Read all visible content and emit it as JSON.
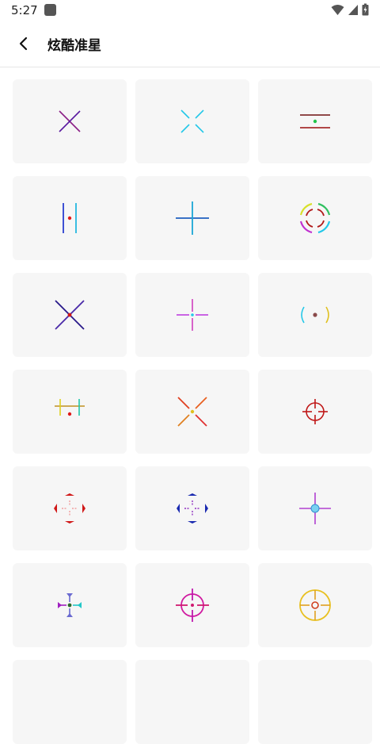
{
  "status_bar": {
    "time": "5:27"
  },
  "header": {
    "title": "炫酷准星"
  },
  "crosshairs": [
    {
      "icon": "crosshair-x-purple-icon"
    },
    {
      "icon": "crosshair-x-cyan-gap-icon"
    },
    {
      "icon": "crosshair-double-line-icon"
    },
    {
      "icon": "crosshair-vertical-bars-icon"
    },
    {
      "icon": "crosshair-plus-blue-icon"
    },
    {
      "icon": "crosshair-dashed-ring-icon"
    },
    {
      "icon": "crosshair-x-indigo-icon"
    },
    {
      "icon": "crosshair-plus-pink-icon"
    },
    {
      "icon": "crosshair-brackets-icon"
    },
    {
      "icon": "crosshair-h-bars-icon"
    },
    {
      "icon": "crosshair-x-orange-icon"
    },
    {
      "icon": "crosshair-scope-red-icon"
    },
    {
      "icon": "crosshair-arrows-red-icon"
    },
    {
      "icon": "crosshair-arrows-blue-icon"
    },
    {
      "icon": "crosshair-plus-circle-icon"
    },
    {
      "icon": "crosshair-arrows-multi-icon"
    },
    {
      "icon": "crosshair-scope-magenta-icon"
    },
    {
      "icon": "crosshair-scope-gold-icon"
    }
  ]
}
